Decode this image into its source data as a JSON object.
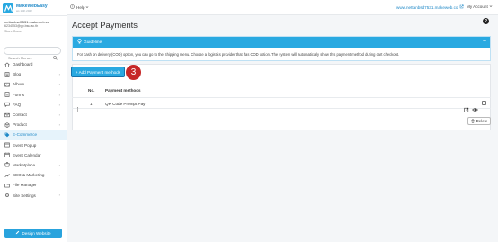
{
  "brand": {
    "name": "MakeWebEasy",
    "tagline": "ws 14th 2022"
  },
  "account": {
    "site": "nettanbsd7531.makeweb.co",
    "email": "6234553@gp.bsu.ac.th",
    "role": "Store Owner"
  },
  "search": {
    "placeholder": "Search Menu..."
  },
  "sidebar": {
    "items": [
      {
        "label": "Dashboard",
        "icon": "home-icon",
        "chevron": false,
        "active": false
      },
      {
        "label": "Blog",
        "icon": "blog-icon",
        "chevron": true,
        "active": false
      },
      {
        "label": "Album",
        "icon": "album-icon",
        "chevron": true,
        "active": false
      },
      {
        "label": "Forms",
        "icon": "forms-icon",
        "chevron": true,
        "active": false
      },
      {
        "label": "FAQ",
        "icon": "faq-icon",
        "chevron": true,
        "active": false
      },
      {
        "label": "Contact",
        "icon": "contact-icon",
        "chevron": true,
        "active": false
      },
      {
        "label": "Product",
        "icon": "product-icon",
        "chevron": true,
        "active": false
      },
      {
        "label": "E-Commerce",
        "icon": "tag-icon",
        "chevron": false,
        "active": true
      },
      {
        "label": "Event Popup",
        "icon": "popup-icon",
        "chevron": false,
        "active": false
      },
      {
        "label": "Event Calendar",
        "icon": "calendar-icon",
        "chevron": false,
        "active": false
      },
      {
        "label": "Marketplace",
        "icon": "marketplace-icon",
        "chevron": true,
        "active": false
      },
      {
        "label": "SEO & Marketing",
        "icon": "seo-icon",
        "chevron": true,
        "active": false
      },
      {
        "label": "File Manager",
        "icon": "folder-icon",
        "chevron": false,
        "active": false
      },
      {
        "label": "Site Settings",
        "icon": "gear-icon",
        "chevron": true,
        "active": false
      }
    ],
    "design_button": "Design Website"
  },
  "topbar": {
    "help": "Help",
    "site_link": "www.nettanbsd7531.makeweb.co",
    "my_account": "My Account"
  },
  "page": {
    "title": "Accept Payments"
  },
  "guide": {
    "title": "Guideline",
    "text": "For cash on delivery (COD) option, you can go to the Shipping menu. Choose a logistics provider that has COD option. The system will automatically show this payment method during cart checkout."
  },
  "toolbar": {
    "add_label": "+ Add Payment methods",
    "step_marker": "3"
  },
  "table": {
    "headers": {
      "no": "No.",
      "method": "Payment methods"
    },
    "rows": [
      {
        "no": "1",
        "method": "QR Code Prompt Pay"
      }
    ],
    "delete_label": "Delete"
  },
  "colors": {
    "accent": "#29a9e1",
    "marker": "#c62828",
    "active_bg": "#e6f3fb"
  }
}
